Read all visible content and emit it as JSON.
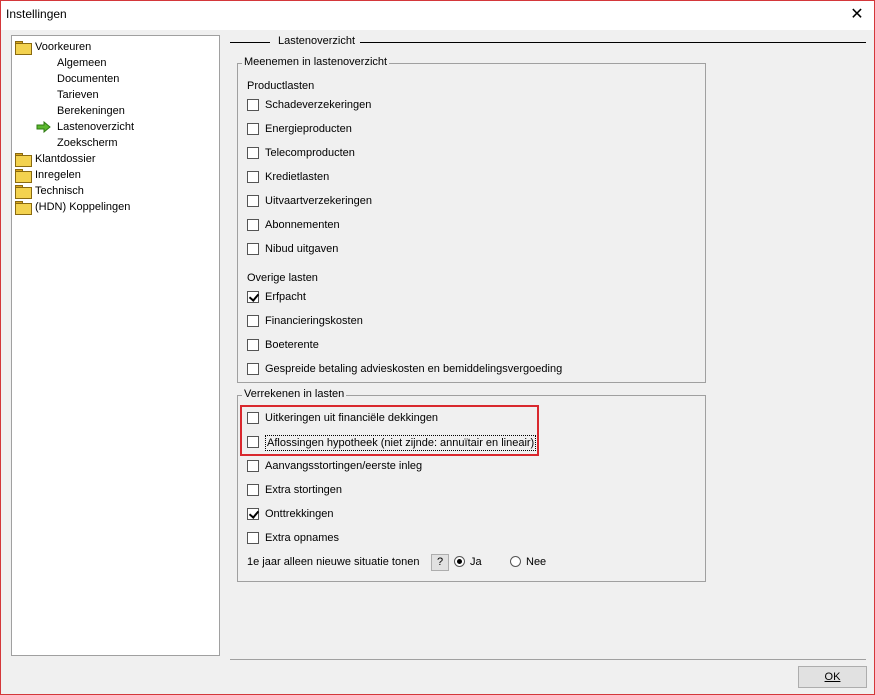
{
  "window": {
    "title": "Instellingen",
    "close_glyph": "✕"
  },
  "tree": {
    "items": [
      {
        "label": "Voorkeuren",
        "icon": "folder-icon"
      },
      {
        "label": "Algemeen"
      },
      {
        "label": "Documenten"
      },
      {
        "label": "Tarieven"
      },
      {
        "label": "Berekeningen"
      },
      {
        "label": "Lastenoverzicht",
        "icon": "arrow-right-icon",
        "selected": true
      },
      {
        "label": "Zoekscherm"
      },
      {
        "label": "Klantdossier",
        "icon": "folder-icon"
      },
      {
        "label": "Inregelen",
        "icon": "folder-icon"
      },
      {
        "label": "Technisch",
        "icon": "folder-icon"
      },
      {
        "label": "(HDN) Koppelingen",
        "icon": "folder-icon"
      }
    ]
  },
  "section_title": "Lastenoverzicht",
  "meenemen": {
    "legend": "Meenemen in lastenoverzicht",
    "product_label": "Productlasten",
    "product_items": [
      {
        "label": "Schadeverzekeringen",
        "checked": false
      },
      {
        "label": "Energieproducten",
        "checked": false
      },
      {
        "label": "Telecomproducten",
        "checked": false
      },
      {
        "label": "Kredietlasten",
        "checked": false
      },
      {
        "label": "Uitvaartverzekeringen",
        "checked": false
      },
      {
        "label": "Abonnementen",
        "checked": false
      },
      {
        "label": "Nibud uitgaven",
        "checked": false
      }
    ],
    "overige_label": "Overige lasten",
    "overige_items": [
      {
        "label": "Erfpacht",
        "checked": true
      },
      {
        "label": "Financieringskosten",
        "checked": false
      },
      {
        "label": "Boeterente",
        "checked": false
      },
      {
        "label": "Gespreide betaling advieskosten en bemiddelingsvergoeding",
        "checked": false
      }
    ]
  },
  "verrekenen": {
    "legend": "Verrekenen in lasten",
    "items": [
      {
        "label": "Uitkeringen uit financiële dekkingen",
        "checked": false
      },
      {
        "label": "Aflossingen hypotheek (niet zijnde: annuïtair en lineair)",
        "checked": false
      },
      {
        "label": "Aanvangsstortingen/eerste inleg",
        "checked": false
      },
      {
        "label": "Extra stortingen",
        "checked": false
      },
      {
        "label": "Onttrekkingen",
        "checked": true
      },
      {
        "label": "Extra opnames",
        "checked": false
      }
    ],
    "first_year_label": "1e jaar alleen nieuwe situatie tonen",
    "help_label": "?",
    "radio_ja": "Ja",
    "radio_nee": "Nee",
    "selected": "Ja"
  },
  "ok_label": "OK",
  "colors": {
    "highlight": "#d9282e",
    "folder": "#f3d24f",
    "arrow": "#5cb82e"
  }
}
